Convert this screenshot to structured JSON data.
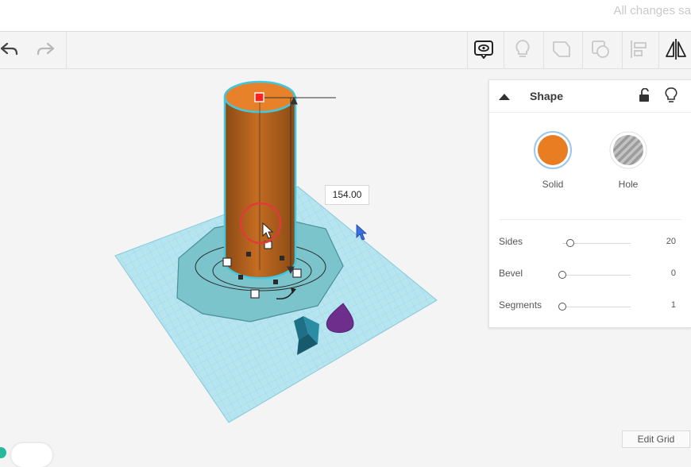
{
  "header": {
    "save_status": "All changes sa"
  },
  "toolbar": {
    "undo_icon": "undo-arrow-icon",
    "redo_icon": "redo-arrow-icon",
    "tools": [
      "notes-icon",
      "lightbulb-icon",
      "shape-outline-icon",
      "group-icon",
      "align-icon",
      "mirror-icon"
    ]
  },
  "inspector": {
    "title": "Shape",
    "solid_label": "Solid",
    "hole_label": "Hole",
    "solid_color": "#e87d22",
    "properties": [
      {
        "label": "Sides",
        "value": "20",
        "level": 0.12
      },
      {
        "label": "Bevel",
        "value": "0",
        "level": 0.0
      },
      {
        "label": "Segments",
        "value": "1",
        "level": 0.0
      }
    ]
  },
  "canvas": {
    "dimension_value": "154.00",
    "edit_grid_label": "Edit Grid"
  }
}
